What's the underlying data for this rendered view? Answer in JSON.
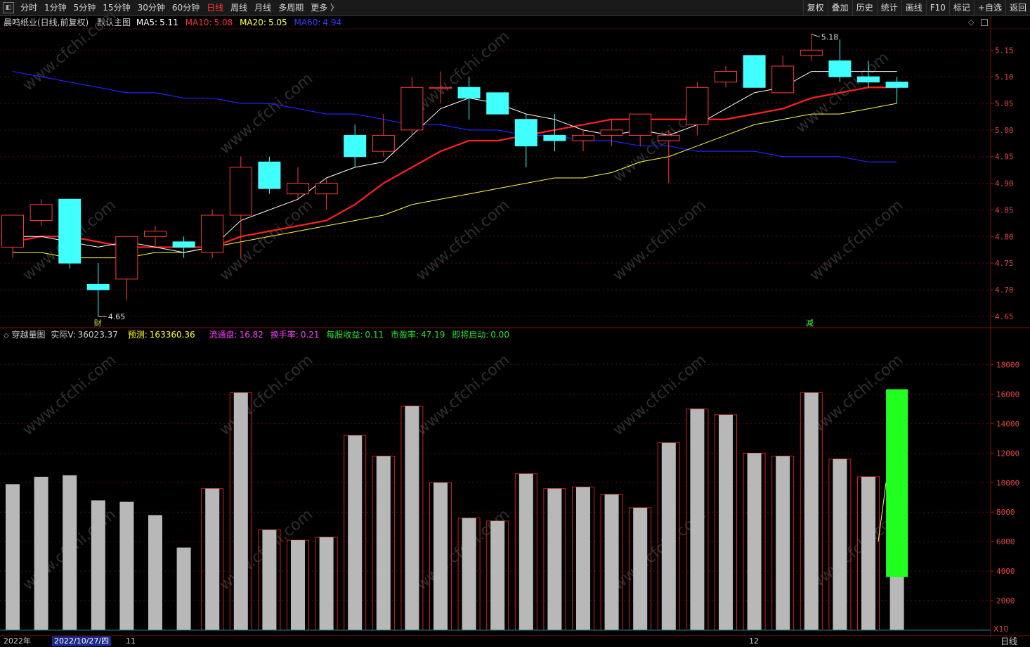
{
  "toolbar": {
    "left_icon": "panel-toggle-icon",
    "periods": [
      {
        "label": "分时",
        "active": false
      },
      {
        "label": "1分钟",
        "active": false
      },
      {
        "label": "5分钟",
        "active": false
      },
      {
        "label": "15分钟",
        "active": false
      },
      {
        "label": "30分钟",
        "active": false
      },
      {
        "label": "60分钟",
        "active": false
      },
      {
        "label": "日线",
        "active": true
      },
      {
        "label": "周线",
        "active": false
      },
      {
        "label": "月线",
        "active": false
      },
      {
        "label": "多周期",
        "active": false
      },
      {
        "label": "更多 〉",
        "active": false
      }
    ],
    "right": [
      "复权",
      "叠加",
      "历史",
      "统计",
      "画线",
      "F10",
      "标记",
      "+自选",
      "返回"
    ]
  },
  "main_info": {
    "stock_name": "晨鸣纸业(日线,前复权)",
    "template": "默认主图",
    "ma5_label": "MA5:",
    "ma5": "5.11",
    "ma10_label": "MA10:",
    "ma10": "5.08",
    "ma20_label": "MA20:",
    "ma20": "5.05",
    "ma60_label": "MA60:",
    "ma60": "4.94",
    "colors": {
      "ma5": "#ffffff",
      "ma10": "#ff2020",
      "ma20": "#ffff40",
      "ma60": "#2222ff"
    }
  },
  "vol_info": {
    "name": "穿越量图",
    "actual_label": "实际V:",
    "actual": "36023.37",
    "predict_label": "预测:",
    "predict": "163360.36",
    "float_label": "流通盘:",
    "float": "16.82",
    "turnover_label": "换手率:",
    "turnover": "0.21",
    "eps_label": "每股收益:",
    "eps": "0.11",
    "pe_label": "市盈率:",
    "pe": "47.19",
    "start_label": "即将启动:",
    "start": "0.00"
  },
  "annotations": {
    "high": "5.18",
    "low": "4.65",
    "cai": "财",
    "jian": "减"
  },
  "price_axis": [
    "5.15",
    "5.10",
    "5.05",
    "5.00",
    "4.95",
    "4.90",
    "4.85",
    "4.80",
    "4.75",
    "4.70",
    "4.65"
  ],
  "volume_axis": [
    "18000",
    "16000",
    "14000",
    "12000",
    "10000",
    "8000",
    "6000",
    "4000",
    "2000"
  ],
  "volume_unit": "X10",
  "bottom": {
    "year": "2022年",
    "cursor_date": "2022/10/27/四",
    "month_11": "11",
    "month_12": "12",
    "period_label": "日线"
  },
  "watermark": "www.cfchi.com",
  "chart_data": {
    "type": "candlestick",
    "price_range": [
      4.63,
      5.19
    ],
    "candles": [
      {
        "o": 4.78,
        "h": 4.84,
        "l": 4.76,
        "c": 4.84
      },
      {
        "o": 4.83,
        "h": 4.87,
        "l": 4.82,
        "c": 4.86
      },
      {
        "o": 4.87,
        "h": 4.87,
        "l": 4.74,
        "c": 4.75
      },
      {
        "o": 4.71,
        "h": 4.75,
        "l": 4.65,
        "c": 4.7
      },
      {
        "o": 4.72,
        "h": 4.8,
        "l": 4.68,
        "c": 4.8
      },
      {
        "o": 4.8,
        "h": 4.82,
        "l": 4.78,
        "c": 4.81
      },
      {
        "o": 4.79,
        "h": 4.8,
        "l": 4.76,
        "c": 4.78
      },
      {
        "o": 4.77,
        "h": 4.85,
        "l": 4.76,
        "c": 4.84
      },
      {
        "o": 4.84,
        "h": 4.95,
        "l": 4.76,
        "c": 4.93
      },
      {
        "o": 4.94,
        "h": 4.95,
        "l": 4.88,
        "c": 4.89
      },
      {
        "o": 4.88,
        "h": 4.93,
        "l": 4.87,
        "c": 4.9
      },
      {
        "o": 4.88,
        "h": 4.91,
        "l": 4.85,
        "c": 4.9
      },
      {
        "o": 4.99,
        "h": 5.01,
        "l": 4.93,
        "c": 4.95
      },
      {
        "o": 4.96,
        "h": 5.03,
        "l": 4.95,
        "c": 4.99
      },
      {
        "o": 5.0,
        "h": 5.1,
        "l": 4.99,
        "c": 5.08
      },
      {
        "o": 5.08,
        "h": 5.11,
        "l": 5.05,
        "c": 5.08
      },
      {
        "o": 5.08,
        "h": 5.1,
        "l": 5.02,
        "c": 5.06
      },
      {
        "o": 5.07,
        "h": 5.07,
        "l": 5.03,
        "c": 5.03
      },
      {
        "o": 5.02,
        "h": 5.03,
        "l": 4.93,
        "c": 4.97
      },
      {
        "o": 4.99,
        "h": 5.03,
        "l": 4.96,
        "c": 4.98
      },
      {
        "o": 4.98,
        "h": 5.0,
        "l": 4.96,
        "c": 4.99
      },
      {
        "o": 4.99,
        "h": 5.02,
        "l": 4.97,
        "c": 5.0
      },
      {
        "o": 4.99,
        "h": 5.03,
        "l": 4.97,
        "c": 5.03
      },
      {
        "o": 4.98,
        "h": 5.0,
        "l": 4.9,
        "c": 4.99
      },
      {
        "o": 5.01,
        "h": 5.09,
        "l": 4.99,
        "c": 5.08
      },
      {
        "o": 5.09,
        "h": 5.12,
        "l": 5.08,
        "c": 5.11
      },
      {
        "o": 5.14,
        "h": 5.14,
        "l": 5.08,
        "c": 5.08
      },
      {
        "o": 5.07,
        "h": 5.14,
        "l": 5.07,
        "c": 5.12
      },
      {
        "o": 5.14,
        "h": 5.18,
        "l": 5.13,
        "c": 5.15
      },
      {
        "o": 5.13,
        "h": 5.17,
        "l": 5.09,
        "c": 5.1
      },
      {
        "o": 5.1,
        "h": 5.13,
        "l": 5.08,
        "c": 5.09
      },
      {
        "o": 5.09,
        "h": 5.1,
        "l": 5.05,
        "c": 5.08
      }
    ],
    "ma5": [
      4.8,
      4.8,
      4.79,
      4.78,
      4.79,
      4.78,
      4.77,
      4.78,
      4.83,
      4.85,
      4.87,
      4.91,
      4.93,
      4.94,
      4.99,
      5.04,
      5.06,
      5.05,
      5.03,
      5.02,
      5.0,
      4.99,
      5.0,
      4.99,
      5.01,
      5.04,
      5.07,
      5.08,
      5.11,
      5.11,
      5.11,
      5.11
    ],
    "ma10": [
      4.79,
      4.8,
      4.8,
      4.79,
      4.78,
      4.78,
      4.78,
      4.78,
      4.8,
      4.81,
      4.82,
      4.83,
      4.86,
      4.9,
      4.93,
      4.96,
      4.98,
      4.98,
      4.99,
      5.0,
      5.01,
      5.02,
      5.02,
      5.02,
      5.02,
      5.02,
      5.03,
      5.04,
      5.06,
      5.07,
      5.08,
      5.08
    ],
    "ma20": [
      4.77,
      4.77,
      4.76,
      4.76,
      4.76,
      4.77,
      4.77,
      4.78,
      4.79,
      4.8,
      4.81,
      4.82,
      4.83,
      4.84,
      4.86,
      4.87,
      4.88,
      4.89,
      4.9,
      4.91,
      4.91,
      4.92,
      4.94,
      4.95,
      4.97,
      4.99,
      5.01,
      5.02,
      5.03,
      5.03,
      5.04,
      5.05
    ],
    "ma60": [
      5.11,
      5.1,
      5.09,
      5.08,
      5.07,
      5.07,
      5.06,
      5.06,
      5.05,
      5.05,
      5.04,
      5.03,
      5.03,
      5.02,
      5.01,
      5.01,
      5.0,
      5.0,
      4.99,
      4.99,
      4.98,
      4.98,
      4.97,
      4.97,
      4.96,
      4.96,
      4.96,
      4.95,
      4.95,
      4.95,
      4.94,
      4.94
    ],
    "volume_range": [
      0,
      19600
    ],
    "volumes": [
      9900,
      10400,
      10500,
      8800,
      8700,
      7800,
      5600,
      9600,
      16100,
      6800,
      6100,
      6300,
      13200,
      11800,
      15200,
      10000,
      7600,
      7400,
      10600,
      9600,
      9700,
      9200,
      8300,
      12700,
      15000,
      14600,
      12000,
      11800,
      16100,
      11600,
      10400,
      3600
    ],
    "volume_outlined": [
      false,
      false,
      false,
      false,
      false,
      false,
      false,
      true,
      true,
      true,
      true,
      true,
      true,
      true,
      true,
      true,
      true,
      true,
      true,
      true,
      true,
      true,
      true,
      true,
      true,
      true,
      true,
      true,
      true,
      true,
      true,
      false
    ],
    "predicted_volume": 16336
  }
}
